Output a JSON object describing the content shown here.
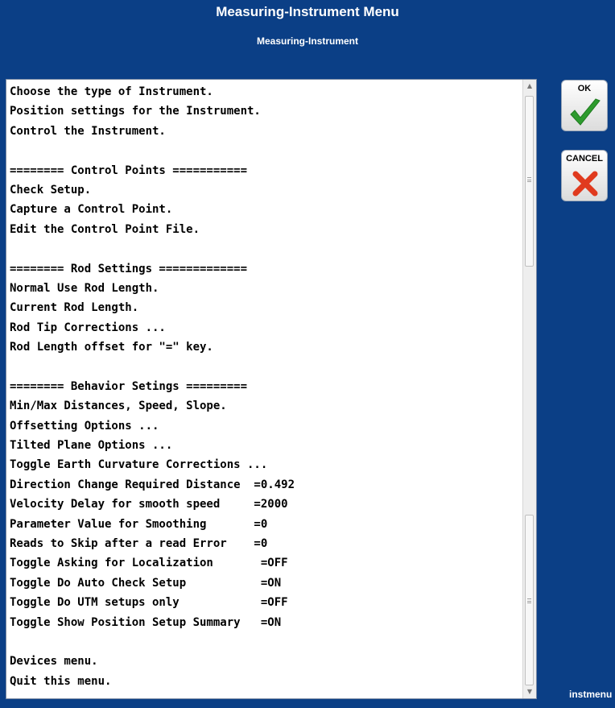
{
  "window": {
    "title": "Measuring-Instrument Menu",
    "subtitle": "Measuring-Instrument"
  },
  "menu": {
    "items": [
      "Choose the type of Instrument.",
      "Position settings for the Instrument.",
      "Control the Instrument.",
      "",
      "======== Control Points ===========",
      "Check Setup.",
      "Capture a Control Point.",
      "Edit the Control Point File.",
      "",
      "======== Rod Settings =============",
      "Normal Use Rod Length.",
      "Current Rod Length.",
      "Rod Tip Corrections ...",
      "Rod Length offset for \"=\" key.",
      "",
      "======== Behavior Setings =========",
      "Min/Max Distances, Speed, Slope.",
      "Offsetting Options ...",
      "Tilted Plane Options ...",
      "Toggle Earth Curvature Corrections ...",
      "Direction Change Required Distance  =0.492",
      "Velocity Delay for smooth speed     =2000",
      "Parameter Value for Smoothing       =0",
      "Reads to Skip after a read Error    =0",
      "Toggle Asking for Localization       =OFF",
      "Toggle Do Auto Check Setup           =ON",
      "Toggle Do UTM setups only            =OFF",
      "Toggle Show Position Setup Summary   =ON",
      "",
      "Devices menu.",
      "Quit this menu."
    ]
  },
  "buttons": {
    "ok": {
      "label": "OK",
      "icon": "checkmark-icon",
      "color": "#2e9b2e"
    },
    "cancel": {
      "label": "CANCEL",
      "icon": "x-icon",
      "color": "#e03a1e"
    }
  },
  "footer": {
    "label": "instmenu"
  },
  "colors": {
    "background": "#0b3f86",
    "panel": "#ffffff"
  }
}
